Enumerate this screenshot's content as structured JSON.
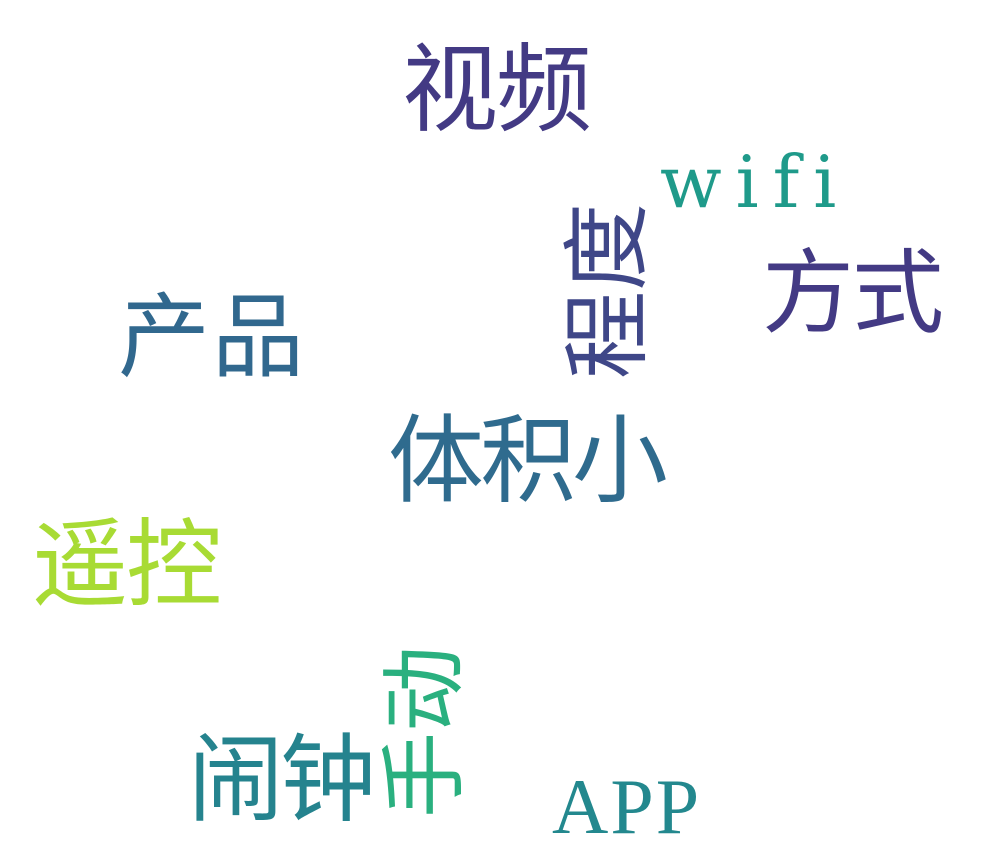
{
  "words": [
    {
      "key": "shipin",
      "text": "视频",
      "color": "#433a84"
    },
    {
      "key": "wifi",
      "text": "wifi",
      "color": "#1f9a8a"
    },
    {
      "key": "chengdu",
      "text": "程度",
      "color": "#3f4788"
    },
    {
      "key": "fangshi",
      "text": "方式",
      "color": "#433a84"
    },
    {
      "key": "chanpin",
      "text": "产品",
      "color": "#31688e"
    },
    {
      "key": "tijixiao",
      "text": "体积小",
      "color": "#2f6b8e"
    },
    {
      "key": "yaokong",
      "text": "遥控",
      "color": "#a8db34"
    },
    {
      "key": "shoudong",
      "text": "手动",
      "color": "#2ab07f"
    },
    {
      "key": "naozhong",
      "text": "闹钟",
      "color": "#25838e"
    },
    {
      "key": "app",
      "text": "APP",
      "color": "#23888e"
    }
  ]
}
